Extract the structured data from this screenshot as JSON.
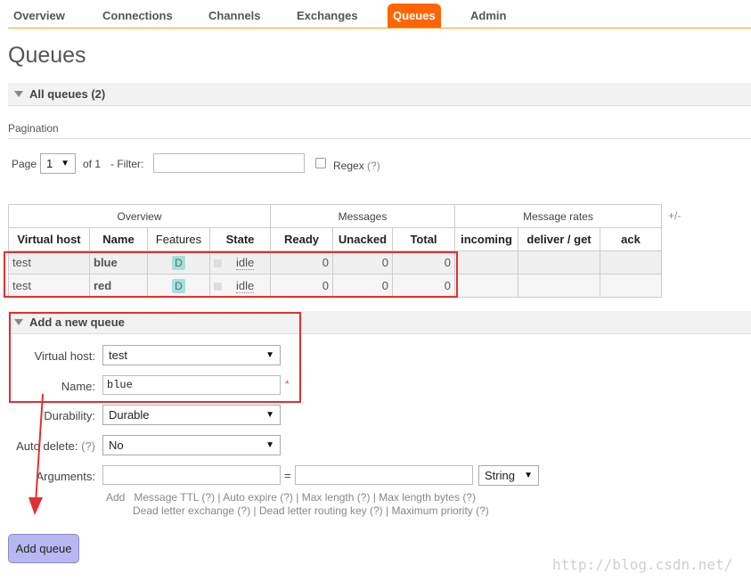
{
  "nav": {
    "items": [
      "Overview",
      "Connections",
      "Channels",
      "Exchanges",
      "Queues",
      "Admin"
    ],
    "active": "Queues"
  },
  "page": {
    "title": "Queues"
  },
  "all_queues": {
    "label": "All queues (2)"
  },
  "pagination": {
    "label": "Pagination",
    "page_label": "Page",
    "page_value": "1",
    "of_label": "of 1",
    "filter_label": "- Filter:",
    "filter_value": "",
    "regex_label": "Regex",
    "help": "(?)"
  },
  "table": {
    "groups": [
      "Overview",
      "Messages",
      "Message rates"
    ],
    "columns": [
      "Virtual host",
      "Name",
      "Features",
      "State",
      "Ready",
      "Unacked",
      "Total",
      "incoming",
      "deliver / get",
      "ack"
    ],
    "plusminus": "+/-",
    "rows": [
      {
        "vhost": "test",
        "name": "blue",
        "feature": "D",
        "state": "idle",
        "ready": "0",
        "unacked": "0",
        "total": "0"
      },
      {
        "vhost": "test",
        "name": "red",
        "feature": "D",
        "state": "idle",
        "ready": "0",
        "unacked": "0",
        "total": "0"
      }
    ]
  },
  "add_queue": {
    "label": "Add a new queue",
    "vhost_label": "Virtual host:",
    "vhost_value": "test",
    "name_label": "Name:",
    "name_value": "blue",
    "required_mark": "*",
    "durability_label": "Durability:",
    "durability_value": "Durable",
    "autodelete_label": "Auto delete:",
    "autodelete_help": "(?)",
    "autodelete_value": "No",
    "arguments_label": "Arguments:",
    "equals": "=",
    "arg_type": "String",
    "hint_add": "Add",
    "hint_line1": [
      {
        "t": "Message TTL",
        "h": "(?)"
      },
      {
        "t": "Auto expire",
        "h": "(?)"
      },
      {
        "t": "Max length",
        "h": "(?)"
      },
      {
        "t": "Max length bytes",
        "h": "(?)"
      }
    ],
    "hint_line2": [
      {
        "t": "Dead letter exchange",
        "h": "(?)"
      },
      {
        "t": "Dead letter routing key",
        "h": "(?)"
      },
      {
        "t": "Maximum priority",
        "h": "(?)"
      }
    ],
    "button": "Add queue"
  },
  "watermark": "http://blog.csdn.net/",
  "colors": {
    "accent": "#ff6600",
    "annotation": "#e03030",
    "button": "#b8b8f0"
  }
}
